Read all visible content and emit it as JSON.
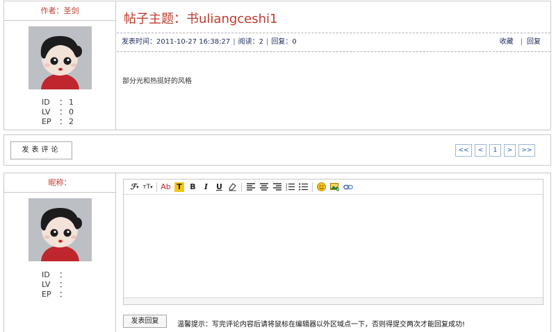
{
  "post": {
    "author_label": "作者：圣剑",
    "stats": [
      {
        "label": "ID",
        "sep": "：",
        "value": "1"
      },
      {
        "label": "LV",
        "sep": "：",
        "value": "0"
      },
      {
        "label": "EP",
        "sep": "：",
        "value": "2"
      }
    ],
    "title": "帖子主题：书uliangceshi1",
    "meta": {
      "published": "发表时间：2011-10-27 16:38:27",
      "pipe": "|",
      "reads": "阅读：2",
      "replies": "回复：0",
      "favorite": "收藏",
      "reply": "回复"
    },
    "body": "部分光和热挺好的风格"
  },
  "nav": {
    "comment_button": "发表评论",
    "pager": {
      "first": "<<",
      "prev": "<",
      "current": "1",
      "next": ">",
      "last": ">>"
    }
  },
  "reply_form": {
    "nickname_label": "昵称：",
    "stats": [
      {
        "label": "ID",
        "sep": "：",
        "value": ""
      },
      {
        "label": "LV",
        "sep": "：",
        "value": ""
      },
      {
        "label": "EP",
        "sep": "：",
        "value": ""
      }
    ],
    "submit_label": "发表回复",
    "hint": "温馨提示：写完评论内容后请将鼠标在编辑器以外区域点一下，否则得提交两次才能回复成功!",
    "toolbar": {
      "font_family": "ℱ",
      "font_size": "тT",
      "font_color": "Ab",
      "highlight": "T",
      "bold": "B",
      "italic": "I",
      "underline": "U"
    }
  },
  "colors": {
    "accent_red": "#c0392b",
    "link_blue": "#1c2a5c",
    "pager_blue": "#1a56a8"
  }
}
